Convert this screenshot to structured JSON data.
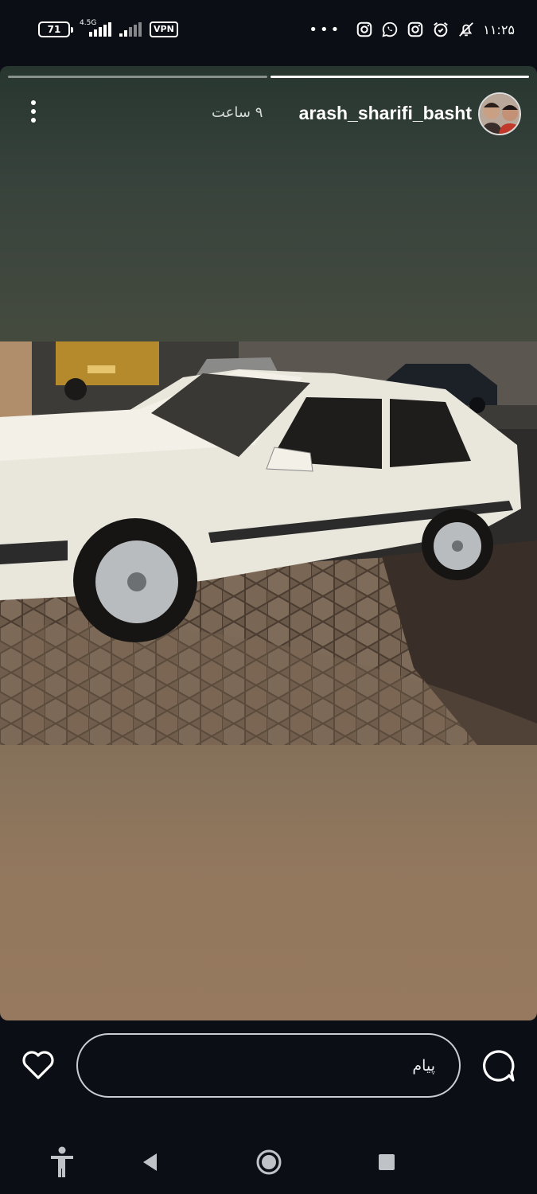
{
  "status_bar": {
    "battery": "71",
    "network_type": "4.5G",
    "vpn_label": "VPN",
    "time": "۱۱:۲۵",
    "overflow": "•••",
    "notification_icons": [
      "instagram-icon",
      "whatsapp-icon",
      "instagram-icon",
      "alarm-icon",
      "mute-icon"
    ]
  },
  "story": {
    "progress_segments": 2,
    "active_segment": 2,
    "username": "arash_sharifi_basht",
    "time_ago": "۹ ساعت",
    "colors": {
      "top": "#283630",
      "bottom": "#96795e"
    }
  },
  "reply_bar": {
    "message_placeholder": "پیام"
  },
  "nav_bar": {
    "icons": [
      "accessibility-icon",
      "back-icon",
      "home-icon",
      "recents-icon"
    ]
  }
}
